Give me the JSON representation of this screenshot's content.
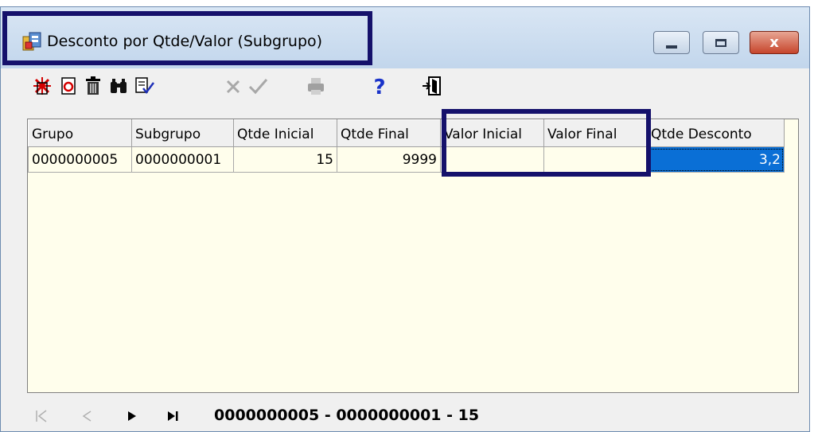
{
  "window": {
    "title": "Desconto por Qtde/Valor (Subgrupo)",
    "controls": {
      "minimize": "minimize",
      "maximize": "maximize",
      "close": "x"
    }
  },
  "toolbar": {
    "buttons": [
      {
        "name": "new-record",
        "icon": "new-icon",
        "enabled": true
      },
      {
        "name": "edit-record",
        "icon": "edit-icon",
        "enabled": true
      },
      {
        "name": "delete-record",
        "icon": "trash-icon",
        "enabled": true
      },
      {
        "name": "search",
        "icon": "binoculars-icon",
        "enabled": true
      },
      {
        "name": "validate",
        "icon": "check-document-icon",
        "enabled": true
      },
      {
        "name": "cancel",
        "icon": "x-icon",
        "enabled": false
      },
      {
        "name": "confirm",
        "icon": "checkmark-icon",
        "enabled": false
      },
      {
        "name": "print",
        "icon": "printer-icon",
        "enabled": false
      },
      {
        "name": "help",
        "icon": "question-icon",
        "enabled": true
      },
      {
        "name": "exit",
        "icon": "exit-door-icon",
        "enabled": true
      }
    ]
  },
  "grid": {
    "columns": [
      "Grupo",
      "Subgrupo",
      "Qtde Inicial",
      "Qtde Final",
      "Valor Inicial",
      "Valor Final",
      "Qtde Desconto"
    ],
    "rows": [
      [
        "0000000005",
        "0000000001",
        "15",
        "9999",
        "",
        "",
        "3,2"
      ]
    ],
    "selected_column": "Qtde Desconto"
  },
  "navigator": {
    "status": "0000000005 - 0000000001 - 15"
  },
  "colors": {
    "highlight_border": "#15116b",
    "grid_background": "#fffeec",
    "selection": "#0a6fd6"
  }
}
